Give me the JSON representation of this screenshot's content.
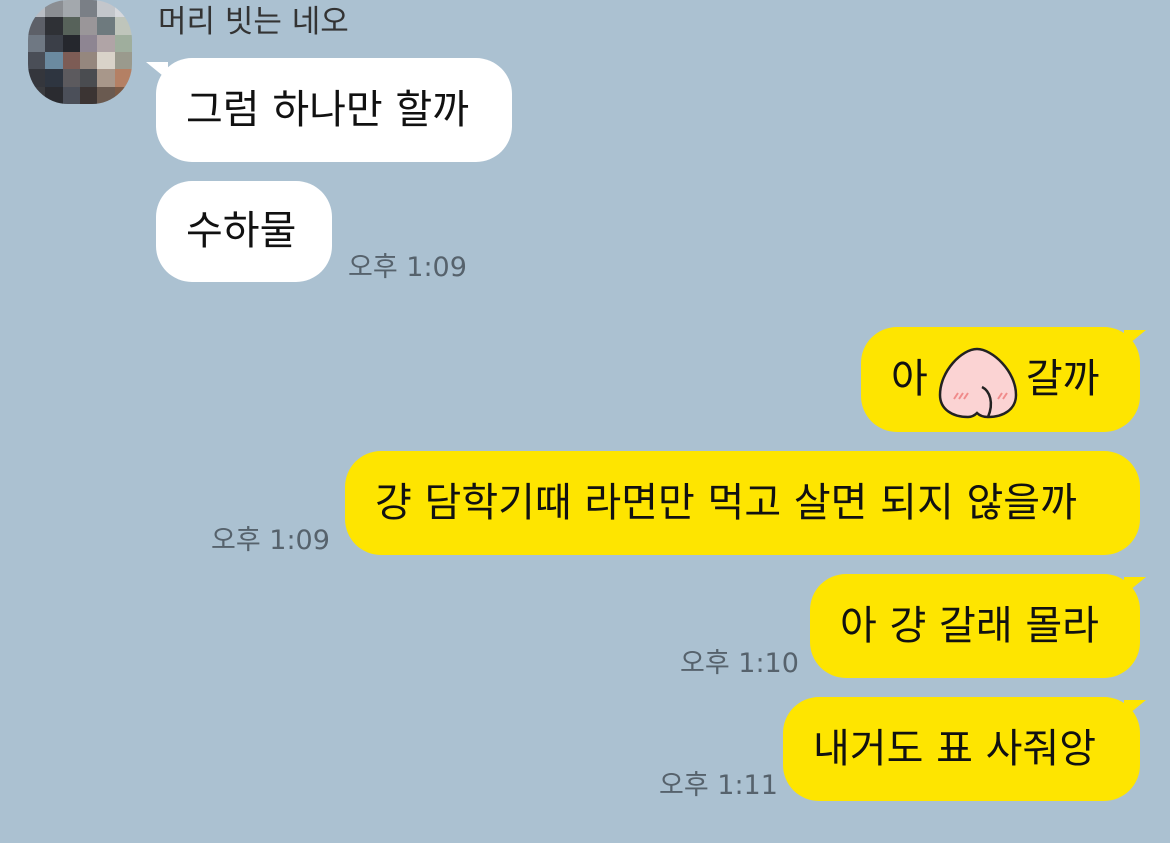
{
  "chat": {
    "sender_name": "머리 빗는 네오",
    "messages": [
      {
        "id": "m1",
        "direction": "incoming",
        "text": "그럼 하나만 할까"
      },
      {
        "id": "m2",
        "direction": "incoming",
        "text": "수하물",
        "time": "오후 1:09"
      },
      {
        "id": "m3",
        "direction": "outgoing",
        "text_before": "아",
        "emoticon": "peach-emoticon",
        "text_after": "갈까"
      },
      {
        "id": "m4",
        "direction": "outgoing",
        "text": "걍 담학기때 라면만 먹고 살면 되지 않을까",
        "time": "오후 1:09"
      },
      {
        "id": "m5",
        "direction": "outgoing",
        "text": "아 걍 갈래 몰라",
        "time": "오후 1:10"
      },
      {
        "id": "m6",
        "direction": "outgoing",
        "text": "내거도 표 사줘앙",
        "time": "오후 1:11"
      }
    ]
  },
  "colors": {
    "background": "#abc1d1",
    "incoming_bubble": "#ffffff",
    "outgoing_bubble": "#fee500",
    "timestamp": "#56626c"
  }
}
